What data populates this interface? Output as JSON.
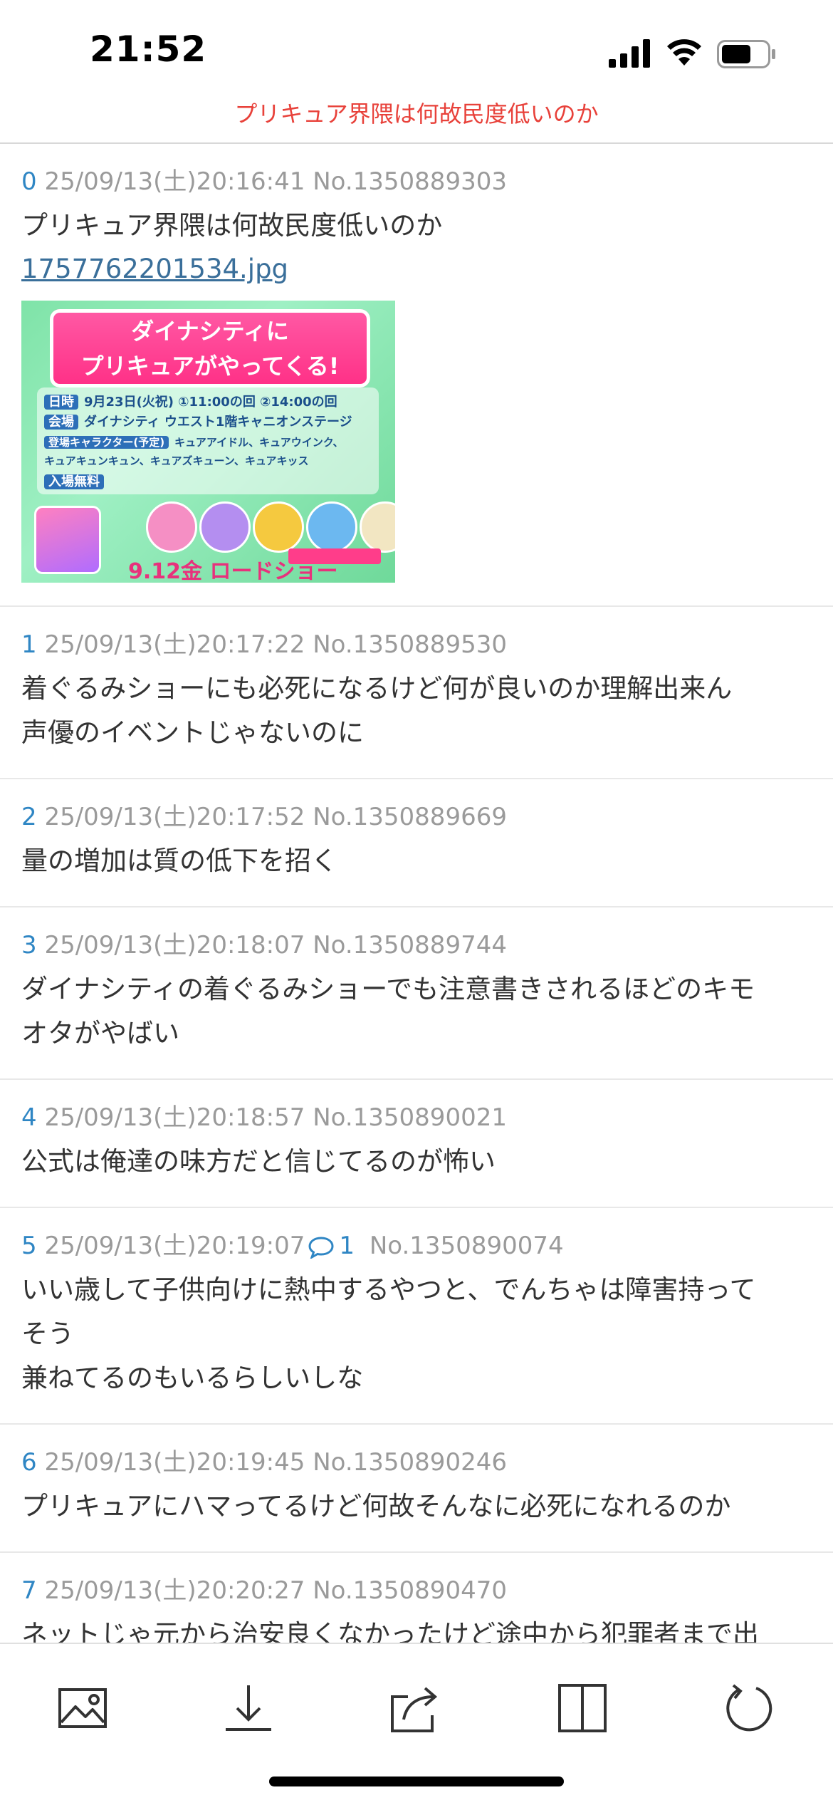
{
  "status_bar": {
    "time": "21:52",
    "icons": [
      "signal-icon",
      "wifi-icon",
      "battery-icon"
    ]
  },
  "thread": {
    "title": "プリキュア界隈は何故民度低いのか"
  },
  "posts": [
    {
      "num": "0",
      "datetime": "25/09/13(土)20:16:41",
      "post_no": "No.1350889303",
      "lines": [
        "プリキュア界隈は何故民度低いのか"
      ],
      "file": "1757762201534.jpg",
      "image": {
        "heading_line1": "ダイナシティに",
        "heading_line2": "プリキュアがやってくる!",
        "rows": [
          {
            "tag": "日時",
            "text": "9月23日(火祝) ①11:00の回 ②14:00の回"
          },
          {
            "tag": "会場",
            "text": "ダイナシティ ウエスト1階キャニオンステージ"
          },
          {
            "tag": "登場キャラクター(予定)",
            "text": "キュアアイドル、キュアウインク、"
          },
          {
            "tag": "",
            "text": "キュアキュンキュン、キュアズキューン、キュアキッス"
          },
          {
            "tag": "入場無料",
            "text": ""
          }
        ],
        "date_text": "9.12金 ロードショー"
      }
    },
    {
      "num": "1",
      "datetime": "25/09/13(土)20:17:22",
      "post_no": "No.1350889530",
      "lines": [
        "着ぐるみショーにも必死になるけど何が良いのか理解出来ん",
        "声優のイベントじゃないのに"
      ]
    },
    {
      "num": "2",
      "datetime": "25/09/13(土)20:17:52",
      "post_no": "No.1350889669",
      "lines": [
        "量の増加は質の低下を招く"
      ]
    },
    {
      "num": "3",
      "datetime": "25/09/13(土)20:18:07",
      "post_no": "No.1350889744",
      "lines": [
        "ダイナシティの着ぐるみショーでも注意書きされるほどのキモ",
        "オタがやばい"
      ]
    },
    {
      "num": "4",
      "datetime": "25/09/13(土)20:18:57",
      "post_no": "No.1350890021",
      "lines": [
        "公式は俺達の味方だと信じてるのが怖い"
      ]
    },
    {
      "num": "5",
      "datetime": "25/09/13(土)20:19:07",
      "reply_count": "1",
      "post_no": "No.1350890074",
      "lines": [
        "いい歳して子供向けに熱中するやつと、でんちゃは障害持って",
        "そう",
        "兼ねてるのもいるらしいしな"
      ]
    },
    {
      "num": "6",
      "datetime": "25/09/13(土)20:19:45",
      "post_no": "No.1350890246",
      "lines": [
        "プリキュアにハマってるけど何故そんなに必死になれるのか"
      ]
    },
    {
      "num": "7",
      "datetime": "25/09/13(土)20:20:27",
      "post_no": "No.1350890470",
      "lines": [
        "ネットじゃ元から治安良くなかったけど途中から犯罪者まで出"
      ]
    }
  ],
  "toolbar": {
    "items": [
      "image-icon",
      "download-icon",
      "share-icon",
      "split-view-icon",
      "reload-icon"
    ]
  },
  "colors": {
    "title_red": "#e8413a",
    "link_blue": "#2f86c4",
    "meta_gray": "#9a9a9a",
    "text": "#333333"
  }
}
